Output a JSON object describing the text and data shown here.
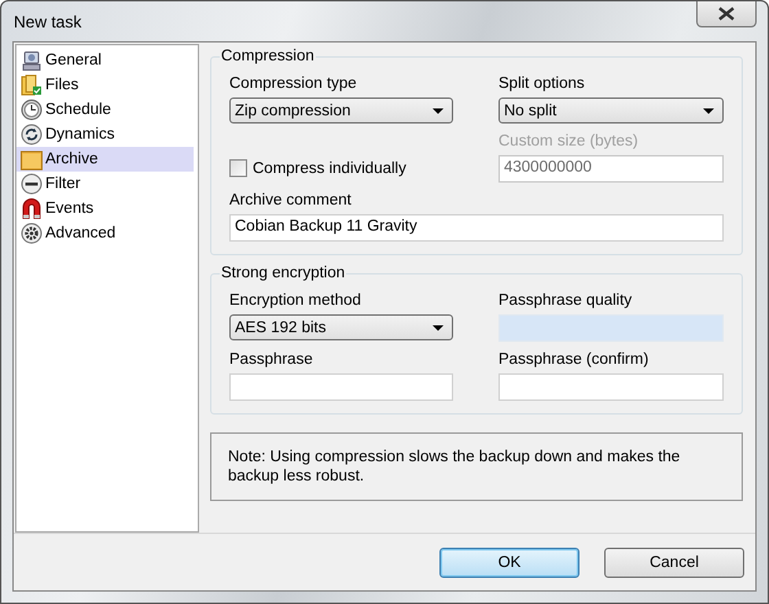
{
  "window": {
    "title": "New task"
  },
  "sidebar": {
    "items": [
      {
        "label": "General",
        "selected": false
      },
      {
        "label": "Files",
        "selected": false
      },
      {
        "label": "Schedule",
        "selected": false
      },
      {
        "label": "Dynamics",
        "selected": false
      },
      {
        "label": "Archive",
        "selected": true
      },
      {
        "label": "Filter",
        "selected": false
      },
      {
        "label": "Events",
        "selected": false
      },
      {
        "label": "Advanced",
        "selected": false
      }
    ]
  },
  "compression": {
    "title": "Compression",
    "compression_type": {
      "label": "Compression type",
      "value": "Zip compression"
    },
    "split_options": {
      "label": "Split options",
      "value": "No split"
    },
    "compress_individually": {
      "label": "Compress individually",
      "checked": false
    },
    "custom_size": {
      "label": "Custom size (bytes)",
      "value": "4300000000",
      "disabled": true
    },
    "archive_comment": {
      "label": "Archive comment",
      "value": "Cobian Backup 11 Gravity"
    }
  },
  "encryption": {
    "title": "Strong encryption",
    "method": {
      "label": "Encryption method",
      "value": "AES 192 bits"
    },
    "quality": {
      "label": "Passphrase quality",
      "level": 0
    },
    "passphrase": {
      "label": "Passphrase"
    },
    "passphrase_confirm": {
      "label": "Passphrase (confirm)"
    }
  },
  "note": "Note: Using compression slows the backup down and makes the backup less robust.",
  "buttons": [
    {
      "label": "OK",
      "default": true
    },
    {
      "label": "Cancel",
      "default": false
    }
  ]
}
